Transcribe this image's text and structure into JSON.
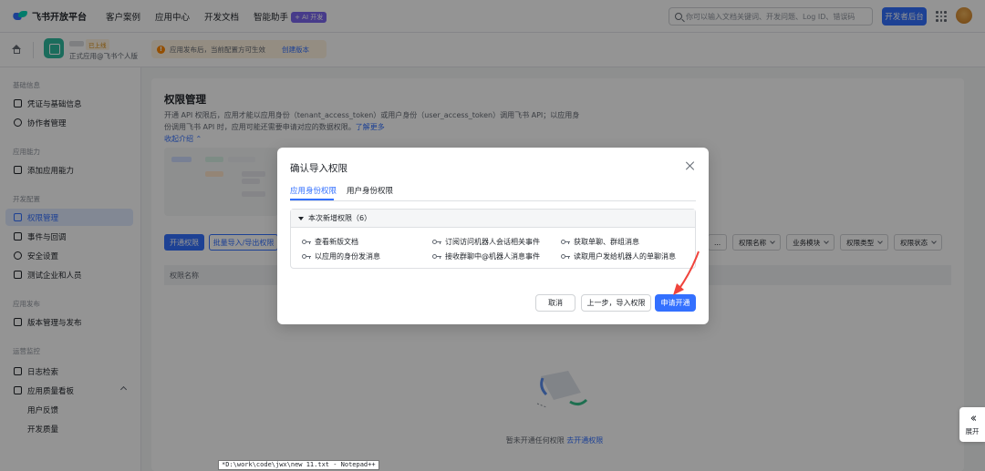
{
  "brand": {
    "name": "飞书开放平台"
  },
  "nav": {
    "items": [
      "客户案例",
      "应用中心",
      "开发文档",
      "智能助手"
    ],
    "ai_badge": "+ AI 开发"
  },
  "search": {
    "placeholder": "你可以输入文档关键词、开发问题、Log ID、错误码"
  },
  "header": {
    "dev_console": "开发者后台"
  },
  "app": {
    "status": "已上线",
    "subtitle": "正式应用@飞书个人版"
  },
  "notice": {
    "text": "应用发布后，当前配置方可生效",
    "link": "创建版本"
  },
  "sidebar": {
    "groups": [
      "基础信息",
      "应用能力",
      "开发配置",
      "应用发布",
      "运营监控"
    ],
    "items": [
      "凭证与基础信息",
      "协作者管理",
      "添加应用能力",
      "权限管理",
      "事件与回调",
      "安全设置",
      "测试企业和人员",
      "版本管理与发布",
      "日志检索",
      "应用质量看板",
      "用户反馈",
      "开发质量"
    ]
  },
  "main": {
    "title": "权限管理",
    "desc": "开通 API 权限后，应用才能以应用身份（tenant_access_token）或用户身份（user_access_token）调用飞书 API；以应用身份调用飞书 API 时，应用可能还需要申请对应的数据权限。",
    "desc_link": "了解更多",
    "collapse": "收起介绍",
    "open_btn": "开通权限",
    "batch_btn": "批量导入/导出权限",
    "filters": [
      "权限名称",
      "业务模块",
      "权限类型",
      "权限状态"
    ],
    "col_header": "权限名称",
    "empty_text": "暂未开通任何权限",
    "empty_link": "去开通权限"
  },
  "modal": {
    "title": "确认导入权限",
    "tabs": [
      "应用身份权限",
      "用户身份权限"
    ],
    "section": "本次新增权限（6）",
    "permissions": [
      "查看新版文档",
      "订阅访问机器人会话相关事件",
      "获取单聊、群组消息",
      "以应用的身份发消息",
      "接收群聊中@机器人消息事件",
      "读取用户发给机器人的单聊消息"
    ],
    "cancel": "取消",
    "prev": "上一步，导入权限",
    "apply": "申请开通"
  },
  "expand": {
    "label": "展开"
  },
  "tooltip": {
    "text": "*D:\\work\\code\\jwx\\new 11.txt - Notepad++"
  },
  "colors": {
    "primary": "#3370ff",
    "annotation_arrow": "#f0443c",
    "app_icon": "#2fba9f"
  }
}
